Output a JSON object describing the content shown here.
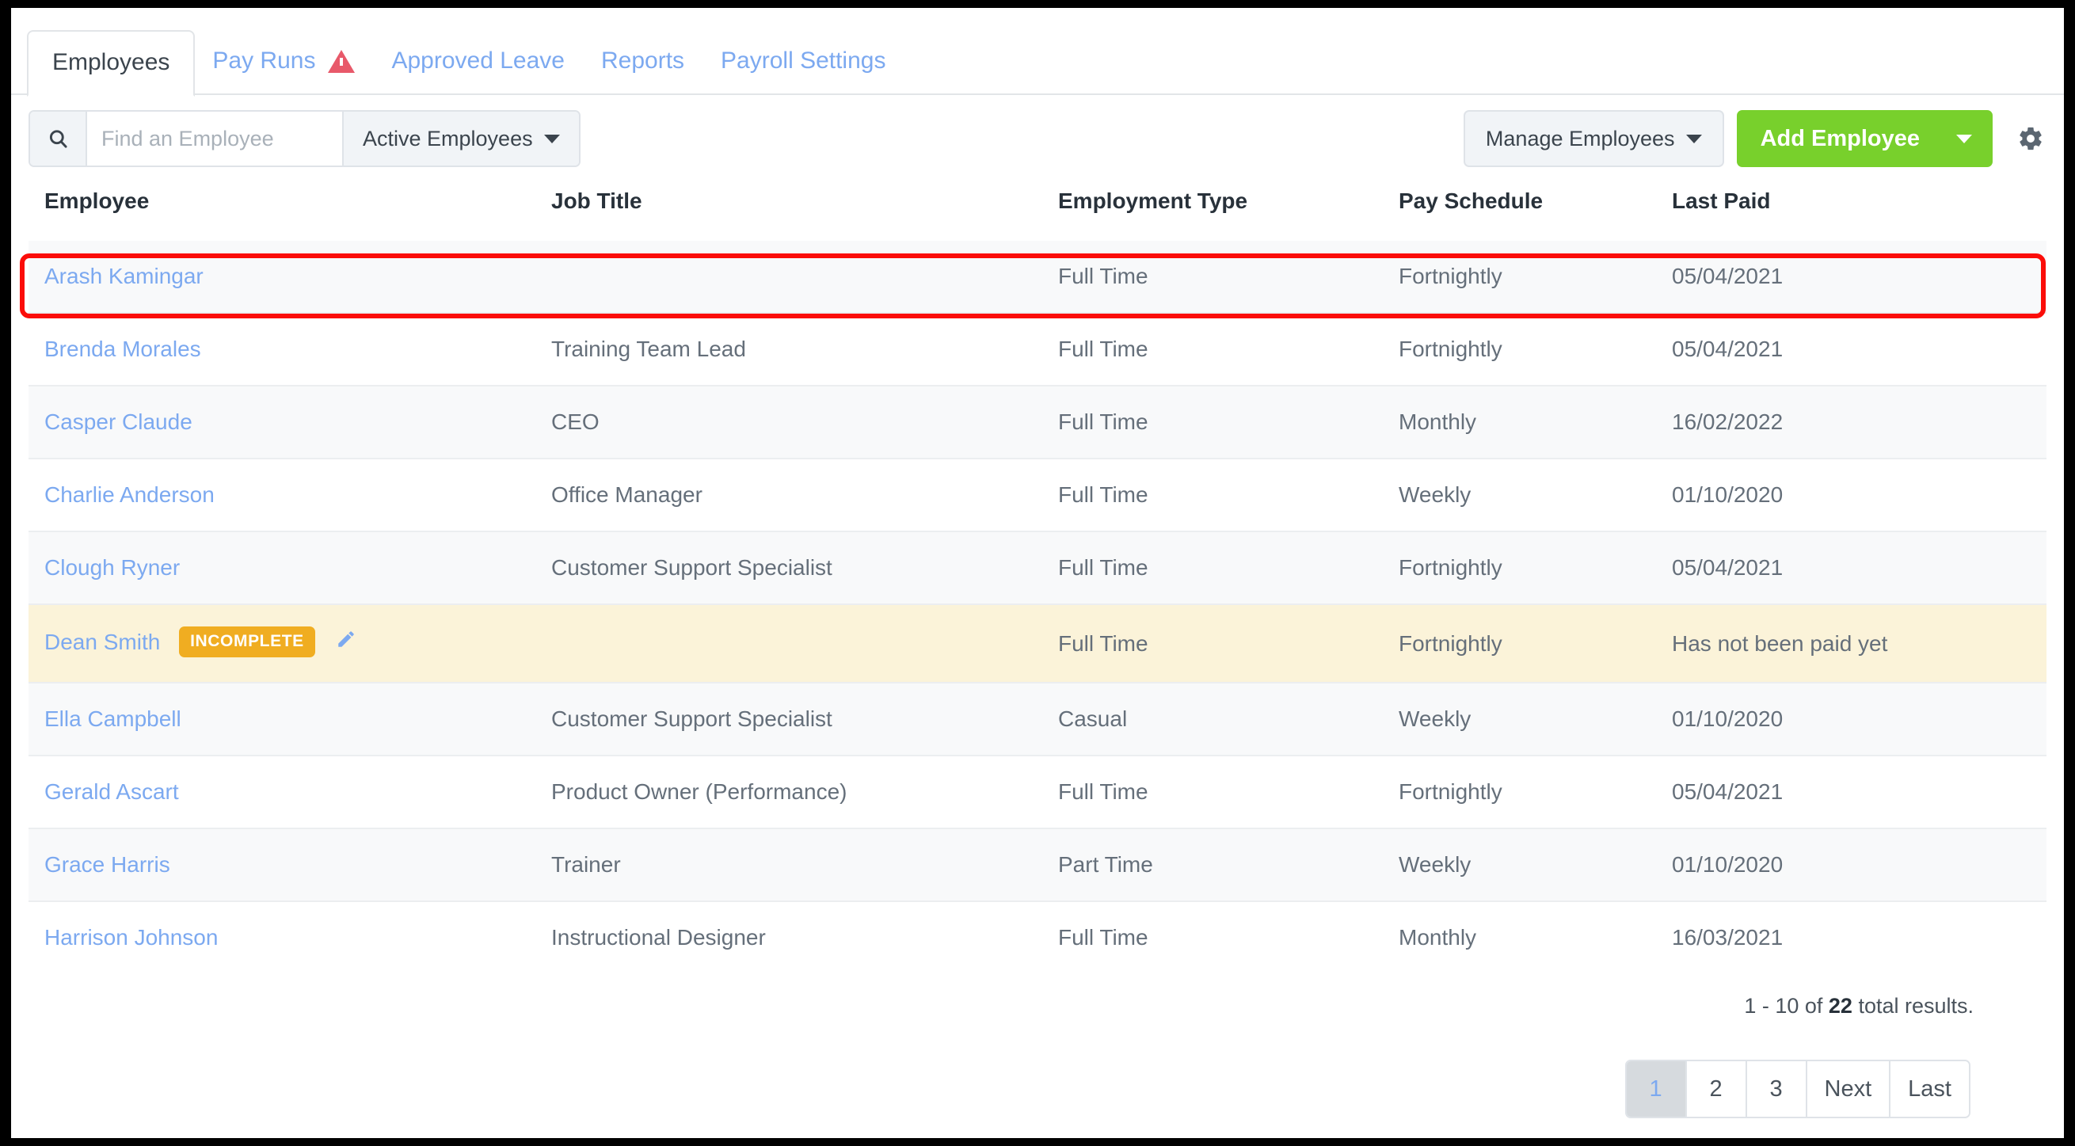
{
  "tabs": [
    {
      "label": "Employees",
      "active": true,
      "warning": false
    },
    {
      "label": "Pay Runs",
      "active": false,
      "warning": true
    },
    {
      "label": "Approved Leave",
      "active": false,
      "warning": false
    },
    {
      "label": "Reports",
      "active": false,
      "warning": false
    },
    {
      "label": "Payroll Settings",
      "active": false,
      "warning": false
    }
  ],
  "toolbar": {
    "search_placeholder": "Find an Employee",
    "search_value": "",
    "filter_label": "Active Employees",
    "manage_label": "Manage Employees",
    "add_label": "Add Employee",
    "add_color": "#78d02c"
  },
  "table": {
    "columns": [
      "Employee",
      "Job Title",
      "Employment Type",
      "Pay Schedule",
      "Last Paid"
    ],
    "rows": [
      {
        "employee": "Arash Kamingar",
        "job_title": "",
        "employment_type": "Full Time",
        "pay_schedule": "Fortnightly",
        "last_paid": "05/04/2021",
        "badge": "",
        "highlighted": true
      },
      {
        "employee": "Brenda Morales",
        "job_title": "Training Team Lead",
        "employment_type": "Full Time",
        "pay_schedule": "Fortnightly",
        "last_paid": "05/04/2021",
        "badge": "",
        "highlighted": false
      },
      {
        "employee": "Casper Claude",
        "job_title": "CEO",
        "employment_type": "Full Time",
        "pay_schedule": "Monthly",
        "last_paid": "16/02/2022",
        "badge": "",
        "highlighted": false
      },
      {
        "employee": "Charlie Anderson",
        "job_title": "Office Manager",
        "employment_type": "Full Time",
        "pay_schedule": "Weekly",
        "last_paid": "01/10/2020",
        "badge": "",
        "highlighted": false
      },
      {
        "employee": "Clough Ryner",
        "job_title": "Customer Support Specialist",
        "employment_type": "Full Time",
        "pay_schedule": "Fortnightly",
        "last_paid": "05/04/2021",
        "badge": "",
        "highlighted": false
      },
      {
        "employee": "Dean Smith",
        "job_title": "",
        "employment_type": "Full Time",
        "pay_schedule": "Fortnightly",
        "last_paid": "Has not been paid yet",
        "badge": "INCOMPLETE",
        "highlighted": false
      },
      {
        "employee": "Ella Campbell",
        "job_title": "Customer Support Specialist",
        "employment_type": "Casual",
        "pay_schedule": "Weekly",
        "last_paid": "01/10/2020",
        "badge": "",
        "highlighted": false
      },
      {
        "employee": "Gerald Ascart",
        "job_title": "Product Owner (Performance)",
        "employment_type": "Full Time",
        "pay_schedule": "Fortnightly",
        "last_paid": "05/04/2021",
        "badge": "",
        "highlighted": false
      },
      {
        "employee": "Grace Harris",
        "job_title": "Trainer",
        "employment_type": "Part Time",
        "pay_schedule": "Weekly",
        "last_paid": "01/10/2020",
        "badge": "",
        "highlighted": false
      },
      {
        "employee": "Harrison Johnson",
        "job_title": "Instructional Designer",
        "employment_type": "Full Time",
        "pay_schedule": "Monthly",
        "last_paid": "16/03/2021",
        "badge": "",
        "highlighted": false
      }
    ]
  },
  "footer": {
    "results_prefix": "1 - 10 of ",
    "results_total": "22",
    "results_suffix": " total results.",
    "pages": [
      {
        "label": "1",
        "current": true
      },
      {
        "label": "2",
        "current": false
      },
      {
        "label": "3",
        "current": false
      },
      {
        "label": "Next",
        "current": false
      },
      {
        "label": "Last",
        "current": false
      }
    ]
  },
  "annotation": {
    "color": "#fb0d09",
    "target": "Arash Kamingar"
  }
}
